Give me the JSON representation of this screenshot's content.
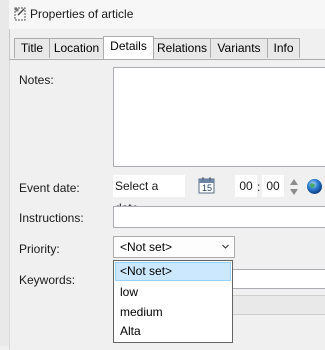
{
  "window": {
    "title": "Properties of article",
    "icon": "article-pin-icon"
  },
  "tabs": [
    {
      "label": "Title",
      "active": false
    },
    {
      "label": "Location",
      "active": false
    },
    {
      "label": "Details",
      "active": true
    },
    {
      "label": "Relations",
      "active": false
    },
    {
      "label": "Variants",
      "active": false
    },
    {
      "label": "Info",
      "active": false
    }
  ],
  "details": {
    "notes_label": "Notes:",
    "notes_value": "",
    "event_date_label": "Event date:",
    "event_date_placeholder": "Select a date",
    "calendar_icon": "calendar-icon",
    "calendar_day": "15",
    "time_hours": "00",
    "time_separator": ":",
    "time_minutes": "00",
    "timezone_icon": "globe-icon",
    "instructions_label": "Instructions:",
    "instructions_value": "",
    "priority_label": "Priority:",
    "priority_value": "<Not set>",
    "keywords_label": "Keywords:"
  },
  "priority_options": [
    "<Not set>",
    "low",
    "medium",
    "Alta"
  ],
  "priority_selected_index": 0,
  "colors": {
    "selection_fill": "#cce8ff",
    "selection_border": "#99d1ff",
    "globe_blue": "#2d7fd3"
  }
}
